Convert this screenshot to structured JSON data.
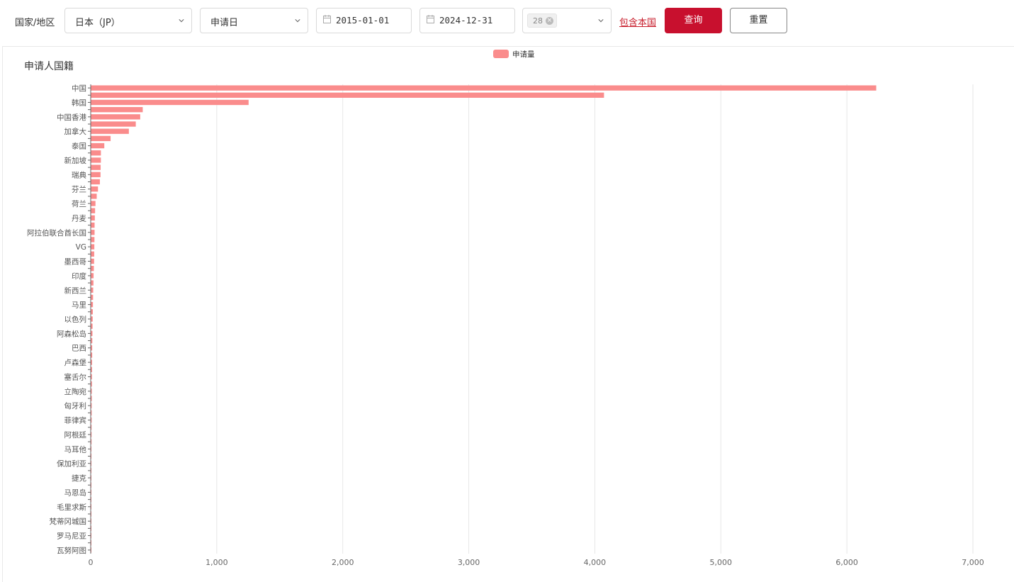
{
  "filters": {
    "region_label": "国家/地区",
    "region_value": "日本（JP）",
    "date_type_value": "申请日",
    "start_date": "2015-01-01",
    "end_date": "2024-12-31",
    "tag_count": "28",
    "include_home_link": "包含本国",
    "query_button": "查询",
    "reset_button": "重置"
  },
  "colors": {
    "bar": "#fa8c8c",
    "primary": "#c8102e",
    "grid": "#e6e6e6"
  },
  "chart_data": {
    "type": "bar",
    "orientation": "horizontal",
    "title": "申请人国籍",
    "legend": {
      "position": "top-center",
      "entries": [
        "申请量"
      ]
    },
    "xlim": [
      0,
      7000
    ],
    "xticks": [
      0,
      1000,
      2000,
      3000,
      4000,
      5000,
      6000,
      7000
    ],
    "xtick_labels": [
      "0",
      "1,000",
      "2,000",
      "3,000",
      "4,000",
      "5,000",
      "6,000",
      "7,000"
    ],
    "grid": true,
    "categories": [
      "中国",
      "",
      "韩国",
      "",
      "中国香港",
      "",
      "加拿大",
      "",
      "泰国",
      "",
      "新加坡",
      "",
      "瑞典",
      "",
      "芬兰",
      "",
      "荷兰",
      "",
      "丹麦",
      "",
      "阿拉伯联合酋长国",
      "",
      "VG",
      "",
      "墨西哥",
      "",
      "印度",
      "",
      "新西兰",
      "",
      "马里",
      "",
      "以色列",
      "",
      "阿森松岛",
      "",
      "巴西",
      "",
      "卢森堡",
      "",
      "塞舌尔",
      "",
      "立陶宛",
      "",
      "匈牙利",
      "",
      "菲律宾",
      "",
      "阿根廷",
      "",
      "马耳他",
      "",
      "保加利亚",
      "",
      "捷克",
      "",
      "马恩岛",
      "",
      "毛里求斯",
      "",
      "梵蒂冈城国",
      "",
      "罗马尼亚",
      "",
      "瓦努阿图"
    ],
    "series": [
      {
        "name": "申请量",
        "values": [
          6230,
          4070,
          1250,
          410,
          390,
          355,
          300,
          155,
          105,
          78,
          78,
          76,
          75,
          70,
          55,
          45,
          35,
          32,
          30,
          28,
          28,
          27,
          26,
          25,
          24,
          22,
          20,
          19,
          17,
          16,
          15,
          14,
          13,
          12,
          11,
          10,
          9,
          9,
          8,
          8,
          7,
          7,
          6,
          6,
          5,
          5,
          5,
          4,
          4,
          4,
          3,
          3,
          3,
          3,
          2,
          2,
          2,
          2,
          2,
          1,
          1,
          1,
          1,
          1,
          1
        ]
      }
    ]
  }
}
